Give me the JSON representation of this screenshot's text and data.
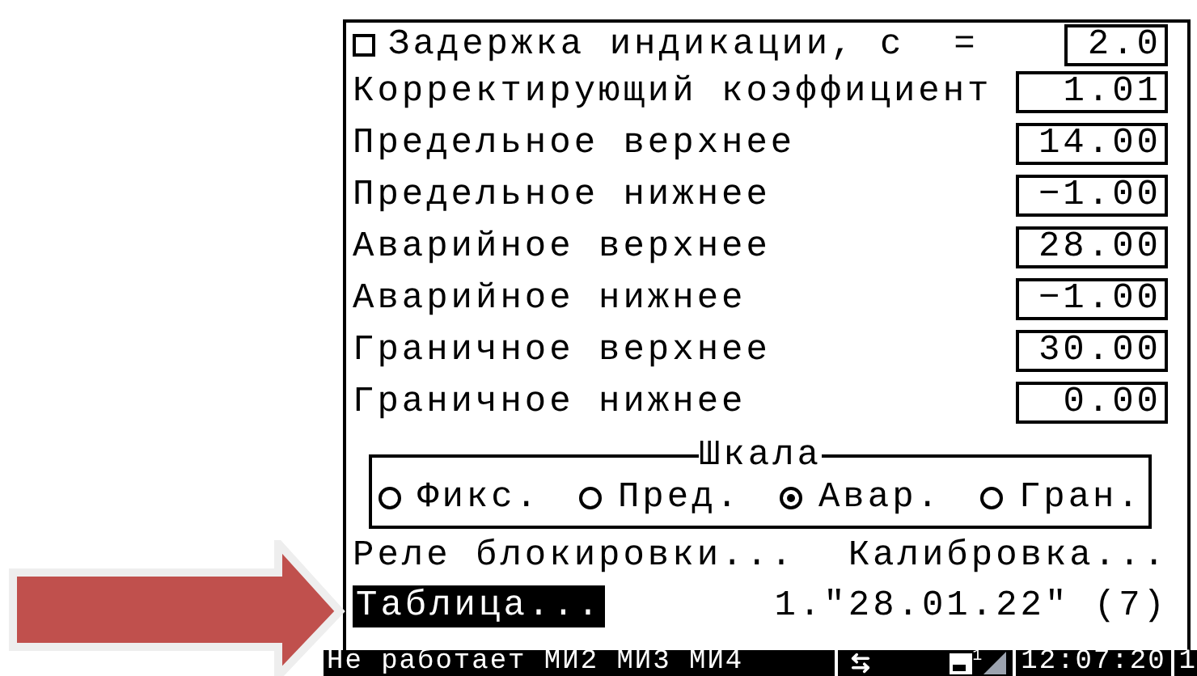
{
  "delay": {
    "label": "Задержка индикации, с  =",
    "checked": false,
    "value": "2.0"
  },
  "parameters": [
    {
      "label": "Корректирующий коэффициент",
      "value": "1.01"
    },
    {
      "label": "Предельное верхнее",
      "value": "14.00"
    },
    {
      "label": "Предельное нижнее",
      "value": "−1.00"
    },
    {
      "label": "Аварийное верхнее",
      "value": "28.00"
    },
    {
      "label": "Аварийное нижнее",
      "value": "−1.00"
    },
    {
      "label": "Граничное верхнее",
      "value": "30.00"
    },
    {
      "label": "Граничное нижнее",
      "value": "0.00"
    }
  ],
  "scale": {
    "title": "Шкала",
    "options": [
      {
        "label": "Фикс.",
        "selected": false
      },
      {
        "label": "Пред.",
        "selected": false
      },
      {
        "label": "Авар.",
        "selected": true
      },
      {
        "label": "Гран.",
        "selected": false
      }
    ]
  },
  "links": [
    "Реле блокировки...",
    "Калибровка..."
  ],
  "table_button": {
    "label": "Таблица...",
    "selected": true
  },
  "calibration_record": "1.\"28.01.22\" (7)",
  "status_bar": {
    "message": "Не работает МИ2 МИ3 МИ4",
    "disk_index": "1",
    "time": "12:07:20",
    "last": "1"
  }
}
